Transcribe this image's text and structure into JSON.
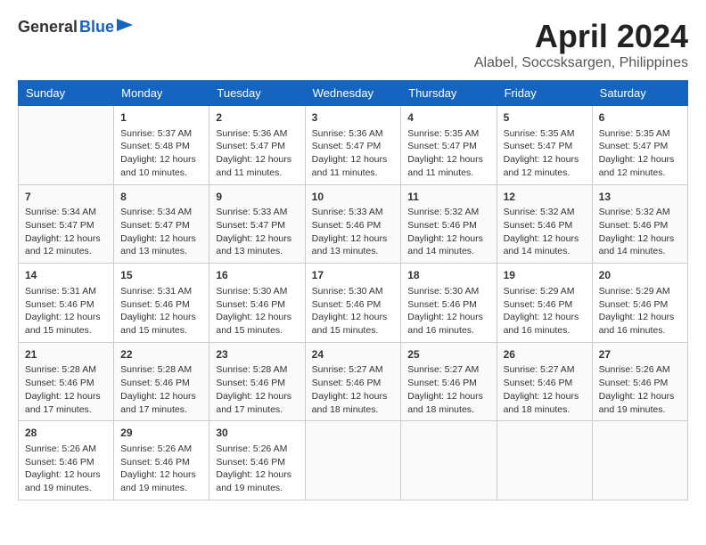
{
  "header": {
    "logo_general": "General",
    "logo_blue": "Blue",
    "month_title": "April 2024",
    "subtitle": "Alabel, Soccsksargen, Philippines"
  },
  "days_of_week": [
    "Sunday",
    "Monday",
    "Tuesday",
    "Wednesday",
    "Thursday",
    "Friday",
    "Saturday"
  ],
  "weeks": [
    [
      {
        "day": "",
        "info": ""
      },
      {
        "day": "1",
        "info": "Sunrise: 5:37 AM\nSunset: 5:48 PM\nDaylight: 12 hours\nand 10 minutes."
      },
      {
        "day": "2",
        "info": "Sunrise: 5:36 AM\nSunset: 5:47 PM\nDaylight: 12 hours\nand 11 minutes."
      },
      {
        "day": "3",
        "info": "Sunrise: 5:36 AM\nSunset: 5:47 PM\nDaylight: 12 hours\nand 11 minutes."
      },
      {
        "day": "4",
        "info": "Sunrise: 5:35 AM\nSunset: 5:47 PM\nDaylight: 12 hours\nand 11 minutes."
      },
      {
        "day": "5",
        "info": "Sunrise: 5:35 AM\nSunset: 5:47 PM\nDaylight: 12 hours\nand 12 minutes."
      },
      {
        "day": "6",
        "info": "Sunrise: 5:35 AM\nSunset: 5:47 PM\nDaylight: 12 hours\nand 12 minutes."
      }
    ],
    [
      {
        "day": "7",
        "info": "Sunrise: 5:34 AM\nSunset: 5:47 PM\nDaylight: 12 hours\nand 12 minutes."
      },
      {
        "day": "8",
        "info": "Sunrise: 5:34 AM\nSunset: 5:47 PM\nDaylight: 12 hours\nand 13 minutes."
      },
      {
        "day": "9",
        "info": "Sunrise: 5:33 AM\nSunset: 5:47 PM\nDaylight: 12 hours\nand 13 minutes."
      },
      {
        "day": "10",
        "info": "Sunrise: 5:33 AM\nSunset: 5:46 PM\nDaylight: 12 hours\nand 13 minutes."
      },
      {
        "day": "11",
        "info": "Sunrise: 5:32 AM\nSunset: 5:46 PM\nDaylight: 12 hours\nand 14 minutes."
      },
      {
        "day": "12",
        "info": "Sunrise: 5:32 AM\nSunset: 5:46 PM\nDaylight: 12 hours\nand 14 minutes."
      },
      {
        "day": "13",
        "info": "Sunrise: 5:32 AM\nSunset: 5:46 PM\nDaylight: 12 hours\nand 14 minutes."
      }
    ],
    [
      {
        "day": "14",
        "info": "Sunrise: 5:31 AM\nSunset: 5:46 PM\nDaylight: 12 hours\nand 15 minutes."
      },
      {
        "day": "15",
        "info": "Sunrise: 5:31 AM\nSunset: 5:46 PM\nDaylight: 12 hours\nand 15 minutes."
      },
      {
        "day": "16",
        "info": "Sunrise: 5:30 AM\nSunset: 5:46 PM\nDaylight: 12 hours\nand 15 minutes."
      },
      {
        "day": "17",
        "info": "Sunrise: 5:30 AM\nSunset: 5:46 PM\nDaylight: 12 hours\nand 15 minutes."
      },
      {
        "day": "18",
        "info": "Sunrise: 5:30 AM\nSunset: 5:46 PM\nDaylight: 12 hours\nand 16 minutes."
      },
      {
        "day": "19",
        "info": "Sunrise: 5:29 AM\nSunset: 5:46 PM\nDaylight: 12 hours\nand 16 minutes."
      },
      {
        "day": "20",
        "info": "Sunrise: 5:29 AM\nSunset: 5:46 PM\nDaylight: 12 hours\nand 16 minutes."
      }
    ],
    [
      {
        "day": "21",
        "info": "Sunrise: 5:28 AM\nSunset: 5:46 PM\nDaylight: 12 hours\nand 17 minutes."
      },
      {
        "day": "22",
        "info": "Sunrise: 5:28 AM\nSunset: 5:46 PM\nDaylight: 12 hours\nand 17 minutes."
      },
      {
        "day": "23",
        "info": "Sunrise: 5:28 AM\nSunset: 5:46 PM\nDaylight: 12 hours\nand 17 minutes."
      },
      {
        "day": "24",
        "info": "Sunrise: 5:27 AM\nSunset: 5:46 PM\nDaylight: 12 hours\nand 18 minutes."
      },
      {
        "day": "25",
        "info": "Sunrise: 5:27 AM\nSunset: 5:46 PM\nDaylight: 12 hours\nand 18 minutes."
      },
      {
        "day": "26",
        "info": "Sunrise: 5:27 AM\nSunset: 5:46 PM\nDaylight: 12 hours\nand 18 minutes."
      },
      {
        "day": "27",
        "info": "Sunrise: 5:26 AM\nSunset: 5:46 PM\nDaylight: 12 hours\nand 19 minutes."
      }
    ],
    [
      {
        "day": "28",
        "info": "Sunrise: 5:26 AM\nSunset: 5:46 PM\nDaylight: 12 hours\nand 19 minutes."
      },
      {
        "day": "29",
        "info": "Sunrise: 5:26 AM\nSunset: 5:46 PM\nDaylight: 12 hours\nand 19 minutes."
      },
      {
        "day": "30",
        "info": "Sunrise: 5:26 AM\nSunset: 5:46 PM\nDaylight: 12 hours\nand 19 minutes."
      },
      {
        "day": "",
        "info": ""
      },
      {
        "day": "",
        "info": ""
      },
      {
        "day": "",
        "info": ""
      },
      {
        "day": "",
        "info": ""
      }
    ]
  ]
}
